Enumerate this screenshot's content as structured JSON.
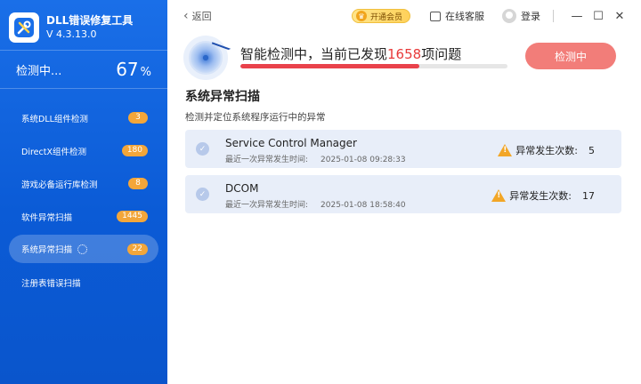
{
  "app": {
    "title": "DLL错误修复工具",
    "version": "V 4.3.13.0"
  },
  "progress": {
    "label": "检测中...",
    "value": "67",
    "unit": "%"
  },
  "sidebar": {
    "items": [
      {
        "label": "系统DLL组件检测",
        "badge": "3"
      },
      {
        "label": "DirectX组件检测",
        "badge": "180"
      },
      {
        "label": "游戏必备运行库检测",
        "badge": "8"
      },
      {
        "label": "软件异常扫描",
        "badge": "1445"
      },
      {
        "label": "系统异常扫描",
        "badge": "22"
      },
      {
        "label": "注册表错误扫描",
        "badge": ""
      }
    ]
  },
  "topbar": {
    "back_label": "返回",
    "vip_label": "开通会员",
    "service_label": "在线客服",
    "login_label": "登录",
    "minimize": "—",
    "maximize": "☐",
    "close": "✕"
  },
  "scan": {
    "text_prefix": "智能检测中，当前已发现",
    "count": "1658",
    "text_suffix": "项问题",
    "progress_fraction": 0.67,
    "button_label": "检测中"
  },
  "section": {
    "title": "系统异常扫描",
    "subtitle": "检测并定位系统程序运行中的异常"
  },
  "records": [
    {
      "name": "Service Control Manager",
      "time_label": "最近一次异常发生时间:",
      "time": "2025-01-08 09:28:33",
      "count_label": "异常发生次数:",
      "count": "5"
    },
    {
      "name": "DCOM",
      "time_label": "最近一次异常发生时间:",
      "time": "2025-01-08 18:58:40",
      "count_label": "异常发生次数:",
      "count": "17"
    }
  ],
  "colors": {
    "sidebar": "#0b5bd6",
    "accent_red": "#e9424b",
    "badge": "#f3a63a",
    "card_bg": "#e8eef9",
    "button": "#f27d79"
  }
}
